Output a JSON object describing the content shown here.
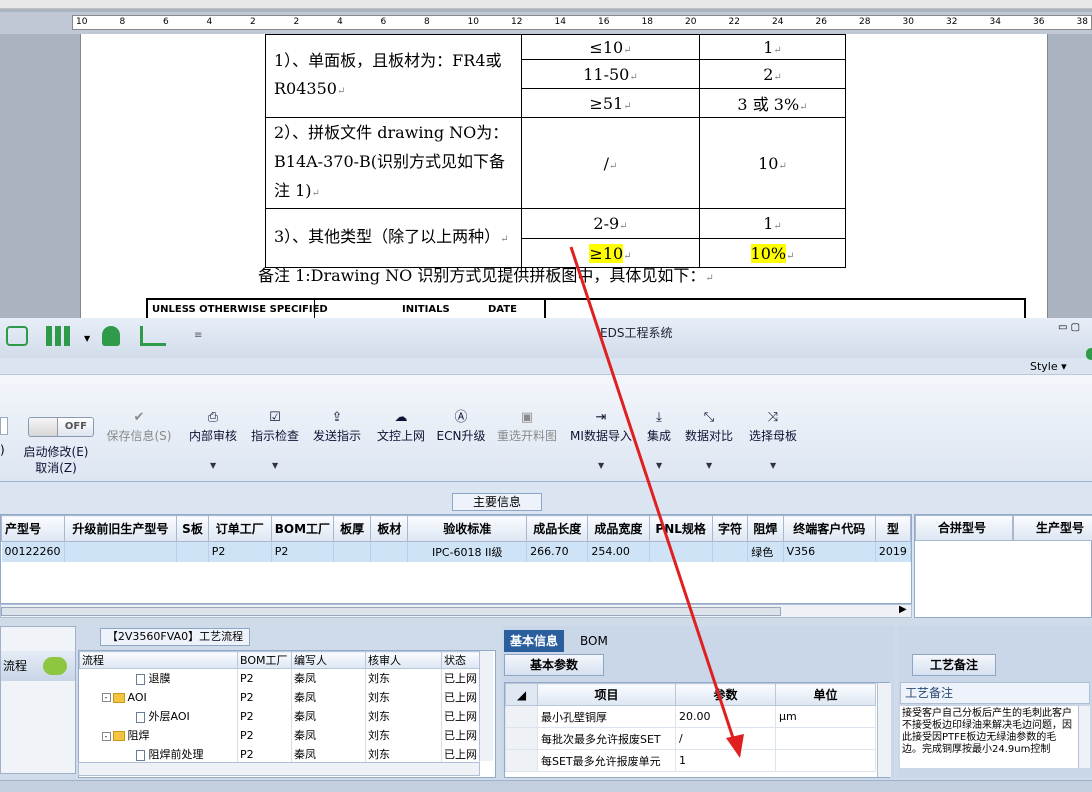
{
  "document": {
    "ruler_ticks": [
      "10",
      "8",
      "6",
      "4",
      "2",
      "2",
      "4",
      "6",
      "8",
      "10",
      "12",
      "14",
      "16",
      "18",
      "20",
      "22",
      "24",
      "26",
      "28",
      "30",
      "32",
      "34",
      "36",
      "38"
    ],
    "table": {
      "rows": [
        {
          "left": "1）、单面板，且板材为：FR4或 R04350",
          "mid": "≤10",
          "right": "1"
        },
        {
          "mid": "11-50",
          "right": "2"
        },
        {
          "mid": "≥51",
          "right": "3 或 3%"
        },
        {
          "left": "2）、拼板文件 drawing NO为：B14A-370-B(识别方式见如下备注 1)",
          "mid": "/",
          "right": "10"
        },
        {
          "left": "3）、其他类型（除了以上两种）",
          "mid": "2-9",
          "right": "1"
        },
        {
          "mid": "≥10",
          "right": "10%"
        }
      ]
    },
    "note": "备注 1:Drawing NO 识别方式见提供拼板图中，具体见如下：",
    "title_block": {
      "unless": "UNLESS OTHERWISE SPECIFIED",
      "initials": "INITIALS",
      "date": "DATE"
    }
  },
  "app": {
    "title": "EDS工程系统",
    "style_label": "Style",
    "toggle_label": "OFF",
    "ribbon": [
      {
        "label": "启动修改(E)",
        "label2": "取消(Z)",
        "icon": "toggle-icon"
      },
      {
        "label": "保存信息(S)",
        "icon": "check-icon",
        "disabled": true
      },
      {
        "label": "内部审核",
        "icon": "printer-icon"
      },
      {
        "label": "指示检查",
        "icon": "checkbox-icon"
      },
      {
        "label": "发送指示",
        "icon": "upload-icon"
      },
      {
        "label": "文控上网",
        "icon": "cloud-upload-icon"
      },
      {
        "label": "ECN升级",
        "icon": "ecn-icon"
      },
      {
        "label": "重选开料图",
        "icon": "image-icon",
        "disabled": true
      },
      {
        "label": "MI数据导入",
        "icon": "import-icon"
      },
      {
        "label": "集成",
        "icon": "download-icon"
      },
      {
        "label": "数据对比",
        "icon": "compare-icon"
      },
      {
        "label": "选择母板",
        "icon": "shuffle-icon"
      }
    ],
    "main_info_label": "主要信息",
    "grid": {
      "headers": [
        "产型号",
        "升级前旧生产型号",
        "S板",
        "订单工厂",
        "BOM工厂",
        "板厚",
        "板材",
        "验收标准",
        "成品长度",
        "成品宽度",
        "PNL规格",
        "字符",
        "阻焊",
        "终端客户代码",
        "型"
      ],
      "row": [
        "00122260",
        "",
        "",
        "P2",
        "P2",
        "",
        "",
        "IPC-6018 II级",
        "266.70",
        "254.00",
        "",
        "",
        "绿色",
        "V356",
        "2019"
      ]
    },
    "grid2_headers": [
      "合拼型号",
      "生产型号"
    ],
    "flow": {
      "left_label": "流程",
      "title": "【2V3560FVA0】工艺流程",
      "headers": [
        "流程",
        "BOM工厂",
        "编写人",
        "核审人",
        "状态"
      ],
      "rows": [
        {
          "name": "退膜",
          "type": "doc",
          "bom": "P2",
          "writer": "秦凤",
          "reviewer": "刘东",
          "status": "已上网"
        },
        {
          "name": "AOI",
          "type": "folder",
          "bom": "P2",
          "writer": "秦凤",
          "reviewer": "刘东",
          "status": "已上网"
        },
        {
          "name": "外层AOI",
          "type": "doc",
          "bom": "P2",
          "writer": "秦凤",
          "reviewer": "刘东",
          "status": "已上网"
        },
        {
          "name": "阻焊",
          "type": "folder",
          "bom": "P2",
          "writer": "秦凤",
          "reviewer": "刘东",
          "status": "已上网"
        },
        {
          "name": "阻焊前处理",
          "type": "doc",
          "bom": "P2",
          "writer": "秦凤",
          "reviewer": "刘东",
          "status": "已上网"
        }
      ]
    },
    "info_tabs": [
      "基本信息",
      "BOM"
    ],
    "params_tab": "基本参数",
    "params": {
      "headers": [
        "项目",
        "参数",
        "单位"
      ],
      "rows": [
        {
          "item": "最小孔壁铜厚",
          "value": "20.00",
          "unit": "μm"
        },
        {
          "item": "每批次最多允许报废SET",
          "value": "/",
          "unit": ""
        },
        {
          "item": "每SET最多允许报废单元",
          "value": "1",
          "unit": ""
        }
      ]
    },
    "remarks_tab": "工艺备注",
    "remarks_header": "工艺备注",
    "remarks_text": "接受客户自己分板后产生的毛刺此客户不接受板边印绿油来解决毛边问题，因此接受因PTFE板边无绿油参数的毛边。完成铜厚按最小24.9um控制"
  },
  "colors": {
    "highlight": "#ffff00",
    "arrow": "#e02020",
    "ribbon_tab": "#2b5e9d",
    "selected_row": "#cfe3f7"
  }
}
